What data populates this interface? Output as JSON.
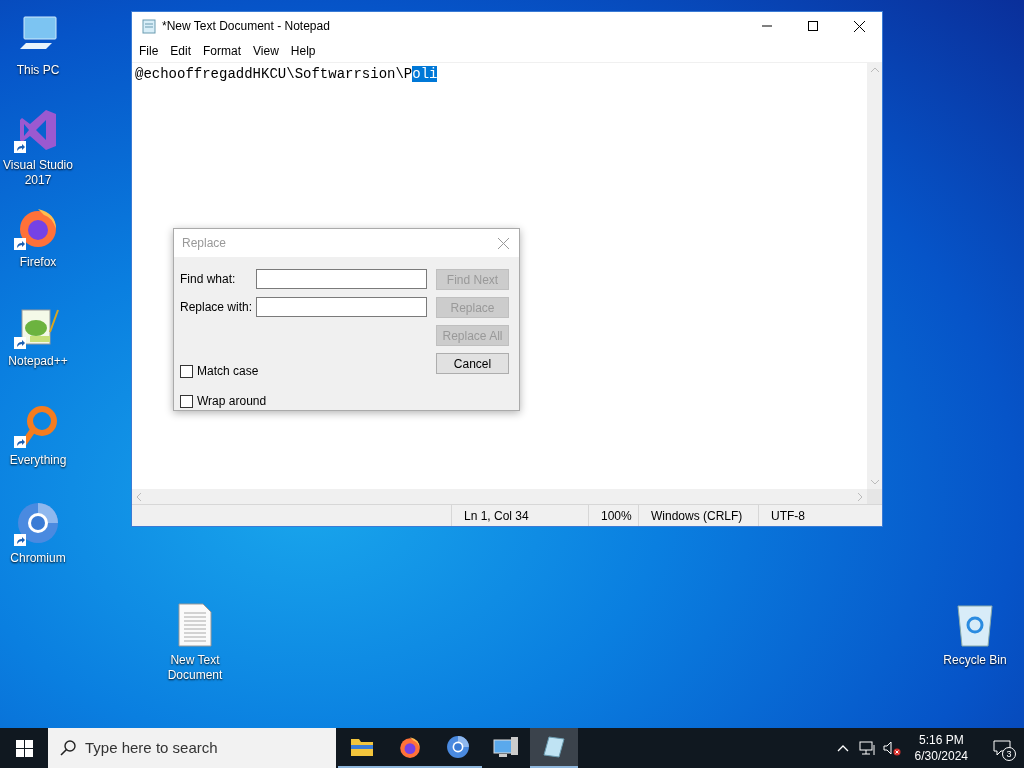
{
  "desktop_icons": [
    {
      "kind": "computer",
      "label": "This PC",
      "shortcut": false
    },
    {
      "kind": "visual-studio",
      "label": "Visual Studio 2017",
      "shortcut": true
    },
    {
      "kind": "firefox",
      "label": "Firefox",
      "shortcut": true
    },
    {
      "kind": "notepadpp",
      "label": "Notepad++",
      "shortcut": true
    },
    {
      "kind": "everything",
      "label": "Everything",
      "shortcut": true
    },
    {
      "kind": "chromium",
      "label": "Chromium",
      "shortcut": true
    },
    {
      "kind": "text-file",
      "label": "New Text Document",
      "shortcut": false
    },
    {
      "kind": "recycle-bin",
      "label": "Recycle Bin",
      "shortcut": false
    }
  ],
  "notepad": {
    "title": "*New Text Document - Notepad",
    "menu": [
      "File",
      "Edit",
      "Format",
      "View",
      "Help"
    ],
    "text_before_selection": "@echooffregaddHKCU\\Softwarrsion\\P",
    "selected_text": "oli",
    "status_bar": [
      "Ln 1, Col 34",
      "100%",
      "Windows (CRLF)",
      "UTF-8"
    ]
  },
  "replace_dialog": {
    "title": "Replace",
    "fields": [
      {
        "label": "Find what:"
      },
      {
        "label": "Replace with:"
      }
    ],
    "buttons": [
      {
        "label": "Find Next",
        "disabled": true
      },
      {
        "label": "Replace",
        "disabled": true
      },
      {
        "label": "Replace All",
        "disabled": true
      },
      {
        "label": "Cancel",
        "disabled": false
      }
    ],
    "checkboxes": [
      {
        "label": "Match case",
        "checked": false
      },
      {
        "label": "Wrap around",
        "checked": false
      }
    ]
  },
  "taskbar": {
    "search_placeholder": "Type here to search",
    "apps": [
      {
        "kind": "file-explorer",
        "running": true,
        "selected": false
      },
      {
        "kind": "firefox",
        "running": true,
        "selected": false
      },
      {
        "kind": "chromium",
        "running": true,
        "selected": false
      },
      {
        "kind": "remote-desktop",
        "running": false,
        "selected": false
      },
      {
        "kind": "notepad",
        "running": true,
        "selected": true
      }
    ],
    "time": "5:16 PM",
    "date": "6/30/2024",
    "notification_count": "3"
  }
}
